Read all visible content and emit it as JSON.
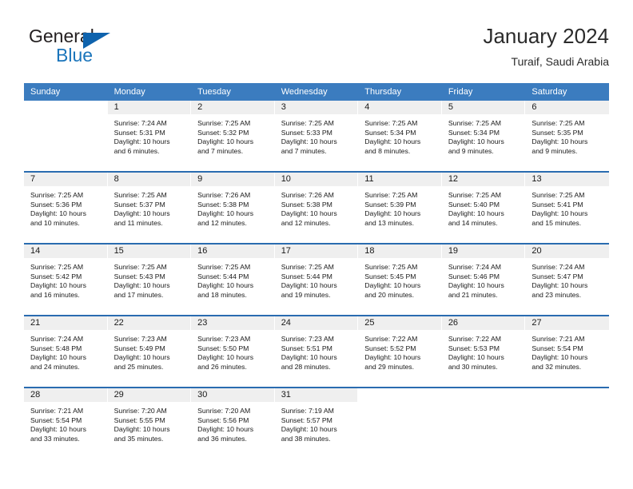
{
  "brand": {
    "name_top": "General",
    "name_bottom": "Blue",
    "accent_color": "#1b75bb",
    "triangle_color": "#0f63ad"
  },
  "header": {
    "title": "January 2024",
    "location": "Turaif, Saudi Arabia"
  },
  "calendar": {
    "header_bg": "#3b7cbf",
    "row_divider_color": "#2a6cb0",
    "daynum_bg": "#efefef",
    "weekday_headers": [
      "Sunday",
      "Monday",
      "Tuesday",
      "Wednesday",
      "Thursday",
      "Friday",
      "Saturday"
    ],
    "weeks": [
      [
        {
          "blank": true
        },
        {
          "day": "1",
          "sunrise": "Sunrise: 7:24 AM",
          "sunset": "Sunset: 5:31 PM",
          "daylight_line1": "Daylight: 10 hours",
          "daylight_line2": "and 6 minutes."
        },
        {
          "day": "2",
          "sunrise": "Sunrise: 7:25 AM",
          "sunset": "Sunset: 5:32 PM",
          "daylight_line1": "Daylight: 10 hours",
          "daylight_line2": "and 7 minutes."
        },
        {
          "day": "3",
          "sunrise": "Sunrise: 7:25 AM",
          "sunset": "Sunset: 5:33 PM",
          "daylight_line1": "Daylight: 10 hours",
          "daylight_line2": "and 7 minutes."
        },
        {
          "day": "4",
          "sunrise": "Sunrise: 7:25 AM",
          "sunset": "Sunset: 5:34 PM",
          "daylight_line1": "Daylight: 10 hours",
          "daylight_line2": "and 8 minutes."
        },
        {
          "day": "5",
          "sunrise": "Sunrise: 7:25 AM",
          "sunset": "Sunset: 5:34 PM",
          "daylight_line1": "Daylight: 10 hours",
          "daylight_line2": "and 9 minutes."
        },
        {
          "day": "6",
          "sunrise": "Sunrise: 7:25 AM",
          "sunset": "Sunset: 5:35 PM",
          "daylight_line1": "Daylight: 10 hours",
          "daylight_line2": "and 9 minutes."
        }
      ],
      [
        {
          "day": "7",
          "sunrise": "Sunrise: 7:25 AM",
          "sunset": "Sunset: 5:36 PM",
          "daylight_line1": "Daylight: 10 hours",
          "daylight_line2": "and 10 minutes."
        },
        {
          "day": "8",
          "sunrise": "Sunrise: 7:25 AM",
          "sunset": "Sunset: 5:37 PM",
          "daylight_line1": "Daylight: 10 hours",
          "daylight_line2": "and 11 minutes."
        },
        {
          "day": "9",
          "sunrise": "Sunrise: 7:26 AM",
          "sunset": "Sunset: 5:38 PM",
          "daylight_line1": "Daylight: 10 hours",
          "daylight_line2": "and 12 minutes."
        },
        {
          "day": "10",
          "sunrise": "Sunrise: 7:26 AM",
          "sunset": "Sunset: 5:38 PM",
          "daylight_line1": "Daylight: 10 hours",
          "daylight_line2": "and 12 minutes."
        },
        {
          "day": "11",
          "sunrise": "Sunrise: 7:25 AM",
          "sunset": "Sunset: 5:39 PM",
          "daylight_line1": "Daylight: 10 hours",
          "daylight_line2": "and 13 minutes."
        },
        {
          "day": "12",
          "sunrise": "Sunrise: 7:25 AM",
          "sunset": "Sunset: 5:40 PM",
          "daylight_line1": "Daylight: 10 hours",
          "daylight_line2": "and 14 minutes."
        },
        {
          "day": "13",
          "sunrise": "Sunrise: 7:25 AM",
          "sunset": "Sunset: 5:41 PM",
          "daylight_line1": "Daylight: 10 hours",
          "daylight_line2": "and 15 minutes."
        }
      ],
      [
        {
          "day": "14",
          "sunrise": "Sunrise: 7:25 AM",
          "sunset": "Sunset: 5:42 PM",
          "daylight_line1": "Daylight: 10 hours",
          "daylight_line2": "and 16 minutes."
        },
        {
          "day": "15",
          "sunrise": "Sunrise: 7:25 AM",
          "sunset": "Sunset: 5:43 PM",
          "daylight_line1": "Daylight: 10 hours",
          "daylight_line2": "and 17 minutes."
        },
        {
          "day": "16",
          "sunrise": "Sunrise: 7:25 AM",
          "sunset": "Sunset: 5:44 PM",
          "daylight_line1": "Daylight: 10 hours",
          "daylight_line2": "and 18 minutes."
        },
        {
          "day": "17",
          "sunrise": "Sunrise: 7:25 AM",
          "sunset": "Sunset: 5:44 PM",
          "daylight_line1": "Daylight: 10 hours",
          "daylight_line2": "and 19 minutes."
        },
        {
          "day": "18",
          "sunrise": "Sunrise: 7:25 AM",
          "sunset": "Sunset: 5:45 PM",
          "daylight_line1": "Daylight: 10 hours",
          "daylight_line2": "and 20 minutes."
        },
        {
          "day": "19",
          "sunrise": "Sunrise: 7:24 AM",
          "sunset": "Sunset: 5:46 PM",
          "daylight_line1": "Daylight: 10 hours",
          "daylight_line2": "and 21 minutes."
        },
        {
          "day": "20",
          "sunrise": "Sunrise: 7:24 AM",
          "sunset": "Sunset: 5:47 PM",
          "daylight_line1": "Daylight: 10 hours",
          "daylight_line2": "and 23 minutes."
        }
      ],
      [
        {
          "day": "21",
          "sunrise": "Sunrise: 7:24 AM",
          "sunset": "Sunset: 5:48 PM",
          "daylight_line1": "Daylight: 10 hours",
          "daylight_line2": "and 24 minutes."
        },
        {
          "day": "22",
          "sunrise": "Sunrise: 7:23 AM",
          "sunset": "Sunset: 5:49 PM",
          "daylight_line1": "Daylight: 10 hours",
          "daylight_line2": "and 25 minutes."
        },
        {
          "day": "23",
          "sunrise": "Sunrise: 7:23 AM",
          "sunset": "Sunset: 5:50 PM",
          "daylight_line1": "Daylight: 10 hours",
          "daylight_line2": "and 26 minutes."
        },
        {
          "day": "24",
          "sunrise": "Sunrise: 7:23 AM",
          "sunset": "Sunset: 5:51 PM",
          "daylight_line1": "Daylight: 10 hours",
          "daylight_line2": "and 28 minutes."
        },
        {
          "day": "25",
          "sunrise": "Sunrise: 7:22 AM",
          "sunset": "Sunset: 5:52 PM",
          "daylight_line1": "Daylight: 10 hours",
          "daylight_line2": "and 29 minutes."
        },
        {
          "day": "26",
          "sunrise": "Sunrise: 7:22 AM",
          "sunset": "Sunset: 5:53 PM",
          "daylight_line1": "Daylight: 10 hours",
          "daylight_line2": "and 30 minutes."
        },
        {
          "day": "27",
          "sunrise": "Sunrise: 7:21 AM",
          "sunset": "Sunset: 5:54 PM",
          "daylight_line1": "Daylight: 10 hours",
          "daylight_line2": "and 32 minutes."
        }
      ],
      [
        {
          "day": "28",
          "sunrise": "Sunrise: 7:21 AM",
          "sunset": "Sunset: 5:54 PM",
          "daylight_line1": "Daylight: 10 hours",
          "daylight_line2": "and 33 minutes."
        },
        {
          "day": "29",
          "sunrise": "Sunrise: 7:20 AM",
          "sunset": "Sunset: 5:55 PM",
          "daylight_line1": "Daylight: 10 hours",
          "daylight_line2": "and 35 minutes."
        },
        {
          "day": "30",
          "sunrise": "Sunrise: 7:20 AM",
          "sunset": "Sunset: 5:56 PM",
          "daylight_line1": "Daylight: 10 hours",
          "daylight_line2": "and 36 minutes."
        },
        {
          "day": "31",
          "sunrise": "Sunrise: 7:19 AM",
          "sunset": "Sunset: 5:57 PM",
          "daylight_line1": "Daylight: 10 hours",
          "daylight_line2": "and 38 minutes."
        },
        {
          "blank": true
        },
        {
          "blank": true
        },
        {
          "blank": true
        }
      ]
    ]
  }
}
